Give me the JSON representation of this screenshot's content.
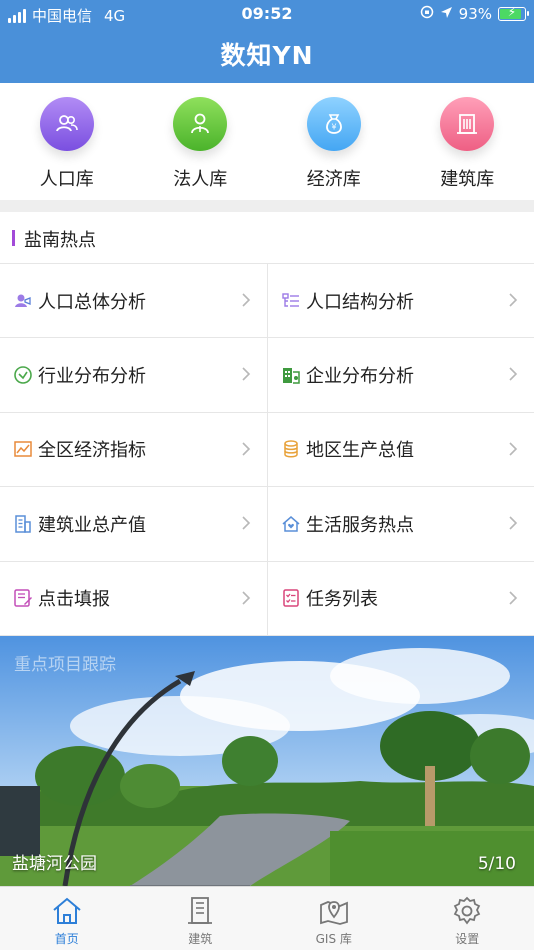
{
  "status_bar": {
    "carrier": "中国电信",
    "network": "4G",
    "time": "09:52",
    "battery": "93%",
    "battery_level": 0.93
  },
  "nav": {
    "title": "数知YN"
  },
  "categories": [
    {
      "label": "人口库",
      "icon": "people-icon",
      "color": "#7a4fe0"
    },
    {
      "label": "法人库",
      "icon": "person-icon",
      "color": "#4bb32b"
    },
    {
      "label": "经济库",
      "icon": "money-bag-icon",
      "color": "#44a6f3"
    },
    {
      "label": "建筑库",
      "icon": "building-icon",
      "color": "#ee5f84"
    }
  ],
  "section": {
    "title": "盐南热点"
  },
  "items": [
    {
      "label": "人口总体分析",
      "icon": "population-icon"
    },
    {
      "label": "人口结构分析",
      "icon": "structure-icon"
    },
    {
      "label": "行业分布分析",
      "icon": "clock-icon"
    },
    {
      "label": "企业分布分析",
      "icon": "enterprise-icon"
    },
    {
      "label": "全区经济指标",
      "icon": "trend-chart-icon"
    },
    {
      "label": "地区生产总值",
      "icon": "coins-stack-icon"
    },
    {
      "label": "建筑业总产值",
      "icon": "building-outline-icon"
    },
    {
      "label": "生活服务热点",
      "icon": "home-heart-icon"
    },
    {
      "label": "点击填报",
      "icon": "edit-form-icon"
    },
    {
      "label": "任务列表",
      "icon": "task-list-icon"
    }
  ],
  "banner": {
    "caption": "盐塘河公园",
    "overlay_text": "重点项目跟踪",
    "page": "5/10"
  },
  "tabbar": [
    {
      "label": "首页",
      "icon": "home-icon",
      "active": true
    },
    {
      "label": "建筑",
      "icon": "building-tab-icon",
      "active": false
    },
    {
      "label": "GIS 库",
      "icon": "map-pin-icon",
      "active": false
    },
    {
      "label": "设置",
      "icon": "gear-icon",
      "active": false
    }
  ]
}
